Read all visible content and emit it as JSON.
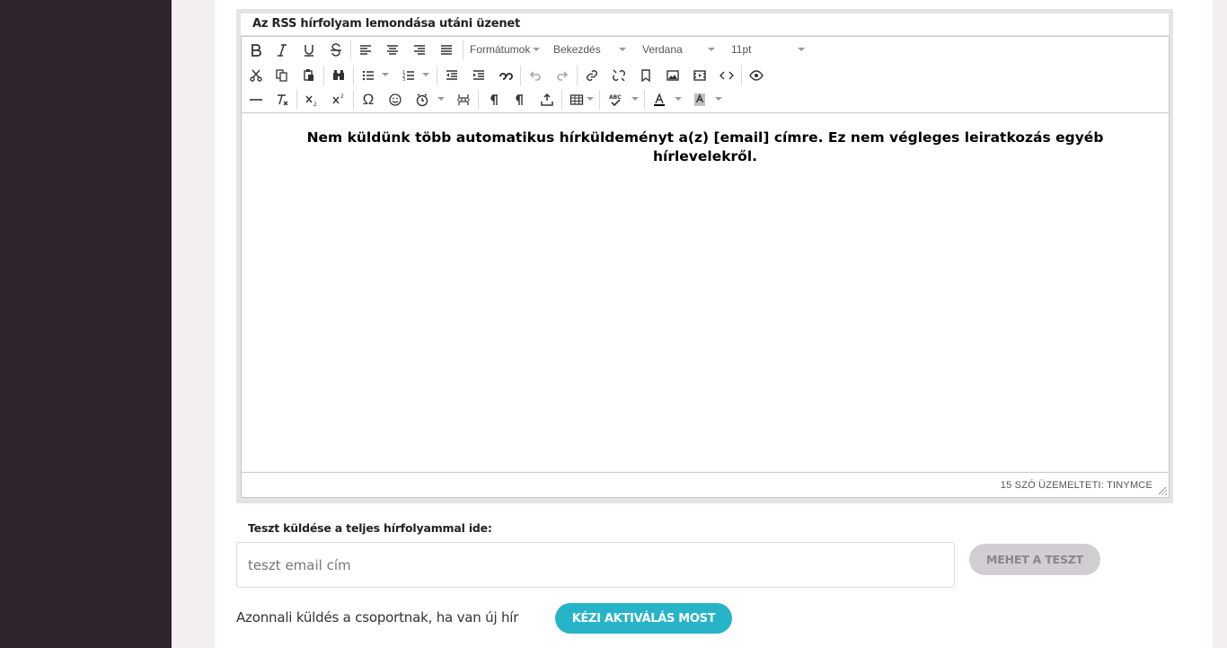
{
  "editor": {
    "label": "Az RSS hírfolyam lemondása utáni üzenet",
    "toolbar": {
      "formats_label": "Formátumok",
      "block_label": "Bekezdés",
      "font_family": "Verdana",
      "font_size": "11pt",
      "icons": [
        "bold-icon",
        "italic-icon",
        "underline-icon",
        "strikethrough-icon",
        "align-left-icon",
        "align-center-icon",
        "align-right-icon",
        "align-justify-icon",
        "cut-icon",
        "copy-icon",
        "paste-icon",
        "find-replace-icon",
        "bullet-list-icon",
        "numbered-list-icon",
        "outdent-icon",
        "indent-icon",
        "blockquote-icon",
        "undo-icon",
        "redo-icon",
        "link-icon",
        "unlink-icon",
        "anchor-icon",
        "image-icon",
        "media-icon",
        "code-icon",
        "preview-icon",
        "horizontal-rule-icon",
        "clear-formatting-icon",
        "subscript-icon",
        "superscript-icon",
        "omega-icon",
        "emoticons-icon",
        "datetime-icon",
        "page-break-icon",
        "ltr-icon",
        "rtl-icon",
        "insert-upload-icon",
        "table-icon",
        "spellcheck-icon",
        "text-color-icon",
        "background-color-icon"
      ]
    },
    "content": "Nem küldünk több automatikus hírküldeményt a(z) [email] címre. Ez nem végleges leiratkozás egyéb hírlevelekről.",
    "status": "15 SZÓ ÜZEMELTETI: TINYMCE"
  },
  "test_send": {
    "label": "Teszt küldése a teljes hírfolyammal ide:",
    "placeholder": "teszt email cím",
    "button_label": "MEHET A TESZT"
  },
  "instant_send": {
    "text": "Azonnali küldés a csoportnak, ha van új hír",
    "button_label": "KÉZI AKTIVÁLÁS MOST"
  },
  "colors": {
    "sidebar": "#2f252f",
    "accent": "#27b4c9",
    "disabled_button": "#d2cdd2",
    "page_background": "#f2eef2"
  }
}
